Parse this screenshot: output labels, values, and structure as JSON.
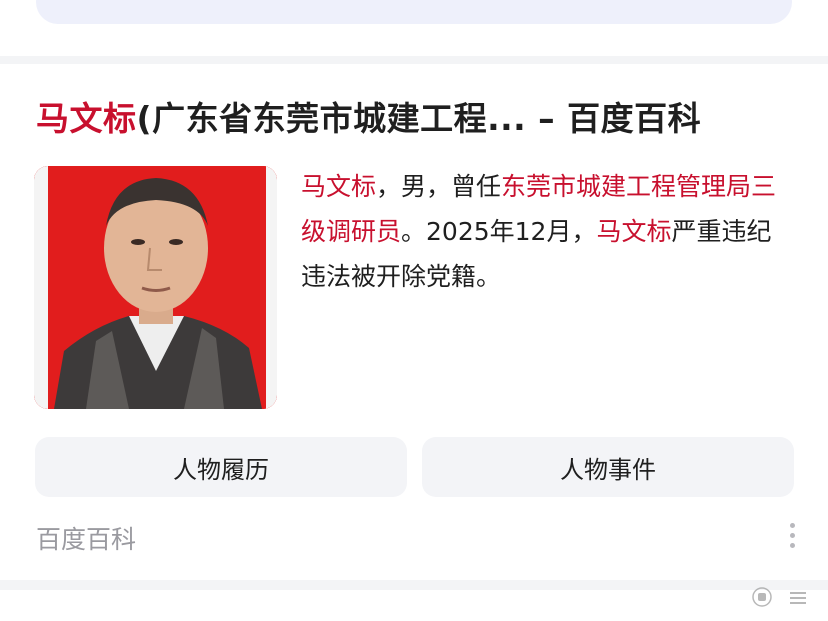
{
  "result": {
    "title_highlight": "马文标",
    "title_rest": "(广东省东莞市城建工程... – 百度百科",
    "description": {
      "name1": "马文标",
      "text1": "，男，曾任",
      "org": "东莞市城建工程管理局三级调研员",
      "text2": "。2025年12月，",
      "name2": "马文标",
      "text3": "严重违纪违法被开除党籍。"
    },
    "buttons": {
      "resume": "人物履历",
      "events": "人物事件"
    },
    "source": "百度百科"
  },
  "colors": {
    "highlight": "#c8102e",
    "photo_background": "#e11d1d",
    "button_bg": "#f3f4f7",
    "band_bg": "#f3f4f6"
  },
  "icons": {
    "more": "more-vertical-icon",
    "watermark": "watermark-icon"
  }
}
